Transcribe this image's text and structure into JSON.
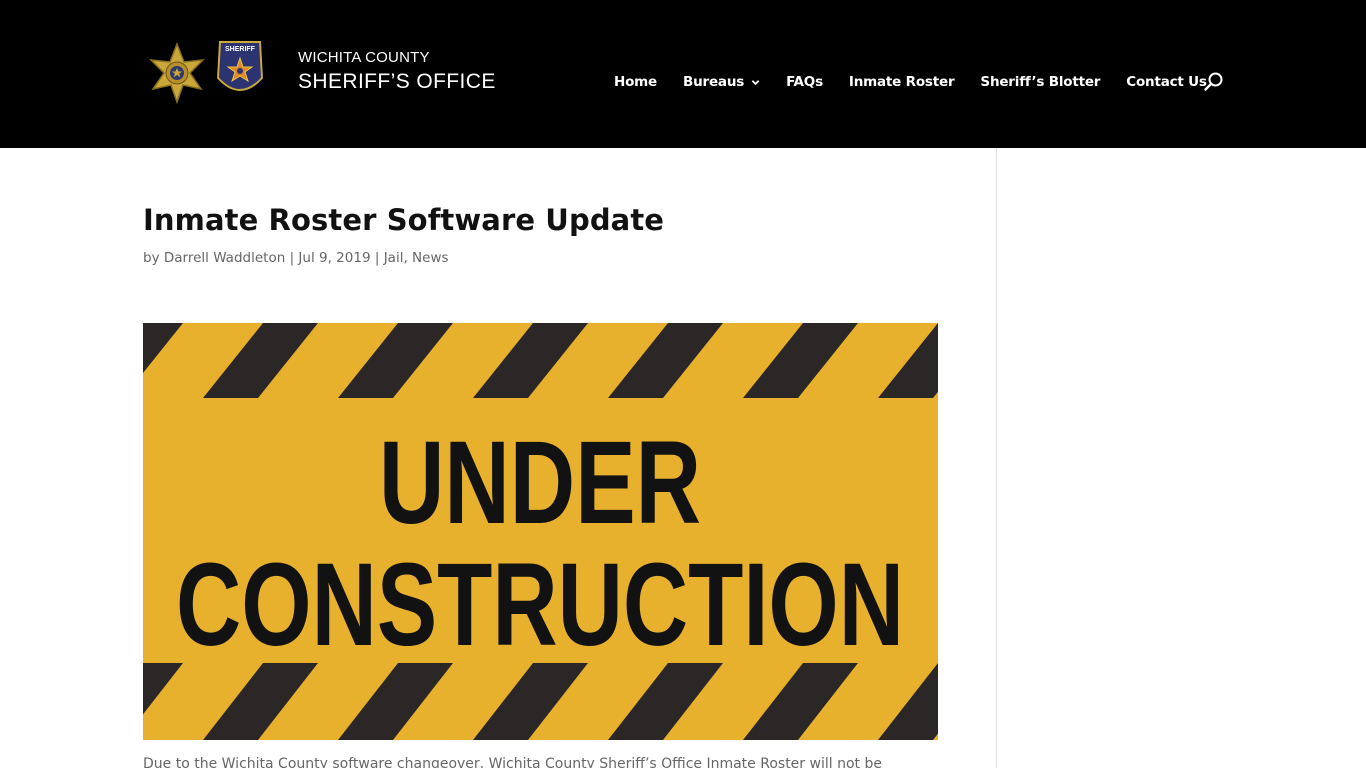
{
  "header": {
    "site_name_line1": "WICHITA COUNTY",
    "site_name_line2": "SHERIFF’S OFFICE",
    "badge_patch_text": "SHERIFF",
    "logo_icons": [
      "sheriff-star-badge",
      "sheriff-shoulder-patch"
    ]
  },
  "nav": {
    "items": [
      {
        "label": "Home"
      },
      {
        "label": "Bureaus",
        "has_dropdown": true
      },
      {
        "label": "FAQs"
      },
      {
        "label": "Inmate Roster"
      },
      {
        "label": "Sheriff’s Blotter"
      },
      {
        "label": "Contact Us"
      }
    ],
    "search_icon": "search-icon"
  },
  "post": {
    "title": "Inmate Roster Software Update",
    "meta": {
      "by": "by",
      "author": "Darrell Waddleton",
      "sep1": "|",
      "date": "Jul 9, 2019",
      "sep2": "|",
      "category1": "Jail",
      "comma": ",",
      "category2": "News"
    },
    "image": {
      "line1": "UNDER",
      "line2": "CONSTRUCTION"
    },
    "excerpt": "Due to the Wichita County software changeover, Wichita County Sheriff’s Office Inmate Roster will not be"
  },
  "colors": {
    "header_bg": "#000000",
    "nav_text": "#ffffff",
    "warning_yellow": "#e8b12d",
    "stripe_dark": "#2b2726",
    "title_text": "#111111",
    "meta_text": "#666666"
  }
}
